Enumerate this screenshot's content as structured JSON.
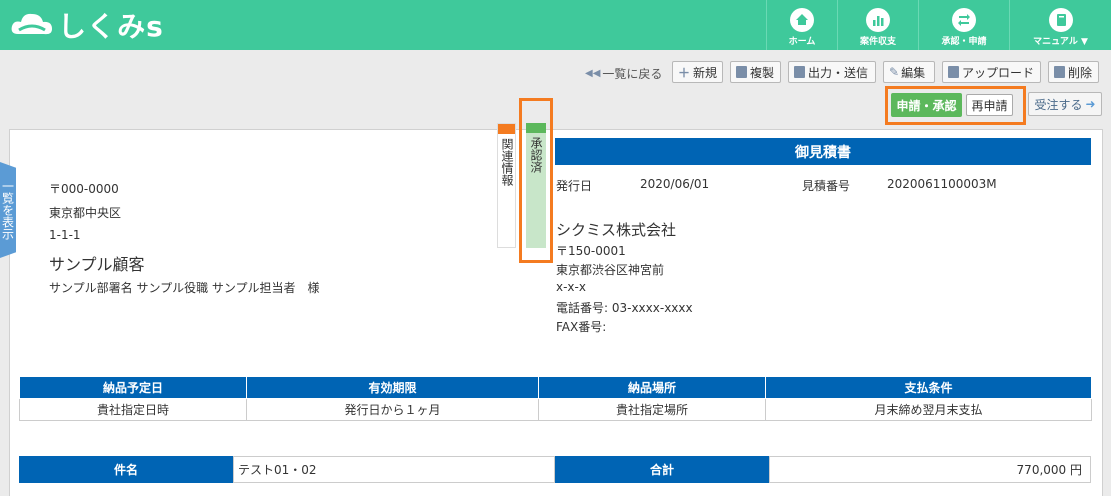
{
  "brand": {
    "name": "しくみs"
  },
  "nav": [
    {
      "label": "ホーム",
      "icon": "home-icon"
    },
    {
      "label": "案件収支",
      "icon": "chart-icon"
    },
    {
      "label": "承認・申請",
      "icon": "refresh-icon"
    },
    {
      "label": "マニュアル ▼",
      "icon": "book-icon"
    }
  ],
  "toolbar": {
    "back": "一覧に戻る",
    "new": "新規",
    "copy": "複製",
    "output": "出力・送信",
    "edit": "編集",
    "upload": "アップロード",
    "delete": "削除"
  },
  "workflow": {
    "approve": "申請・承認",
    "reapply": "再申請",
    "order": "受注する"
  },
  "side_tab": "一覧を表示",
  "tabs": {
    "related": "関連情報",
    "approved": "承認済"
  },
  "customer": {
    "postal": "〒000-0000",
    "address1": "東京都中央区",
    "address2": "1-1-1",
    "name": "サンプル顧客",
    "contact": "サンプル部署名 サンプル役職 サンプル担当者　様"
  },
  "doc": {
    "title": "御見積書",
    "issue_label": "発行日",
    "issue_date": "2020/06/01",
    "number_label": "見積番号",
    "number": "2020061100003M"
  },
  "company": {
    "name": "シクミス株式会社",
    "postal": "〒150-0001",
    "address1": "東京都渋谷区神宮前",
    "address2": "x-x-x",
    "phone": "電話番号:  03-xxxx-xxxx",
    "fax": "FAX番号:"
  },
  "terms": {
    "headers": [
      "納品予定日",
      "有効期限",
      "納品場所",
      "支払条件"
    ],
    "values": [
      "貴社指定日時",
      "発行日から１ヶ月",
      "貴社指定場所",
      "月末締め翌月末支払"
    ]
  },
  "summary": {
    "subject_label": "件名",
    "subject": "テスト01・02",
    "total_label": "合計",
    "total": "770,000 円"
  }
}
